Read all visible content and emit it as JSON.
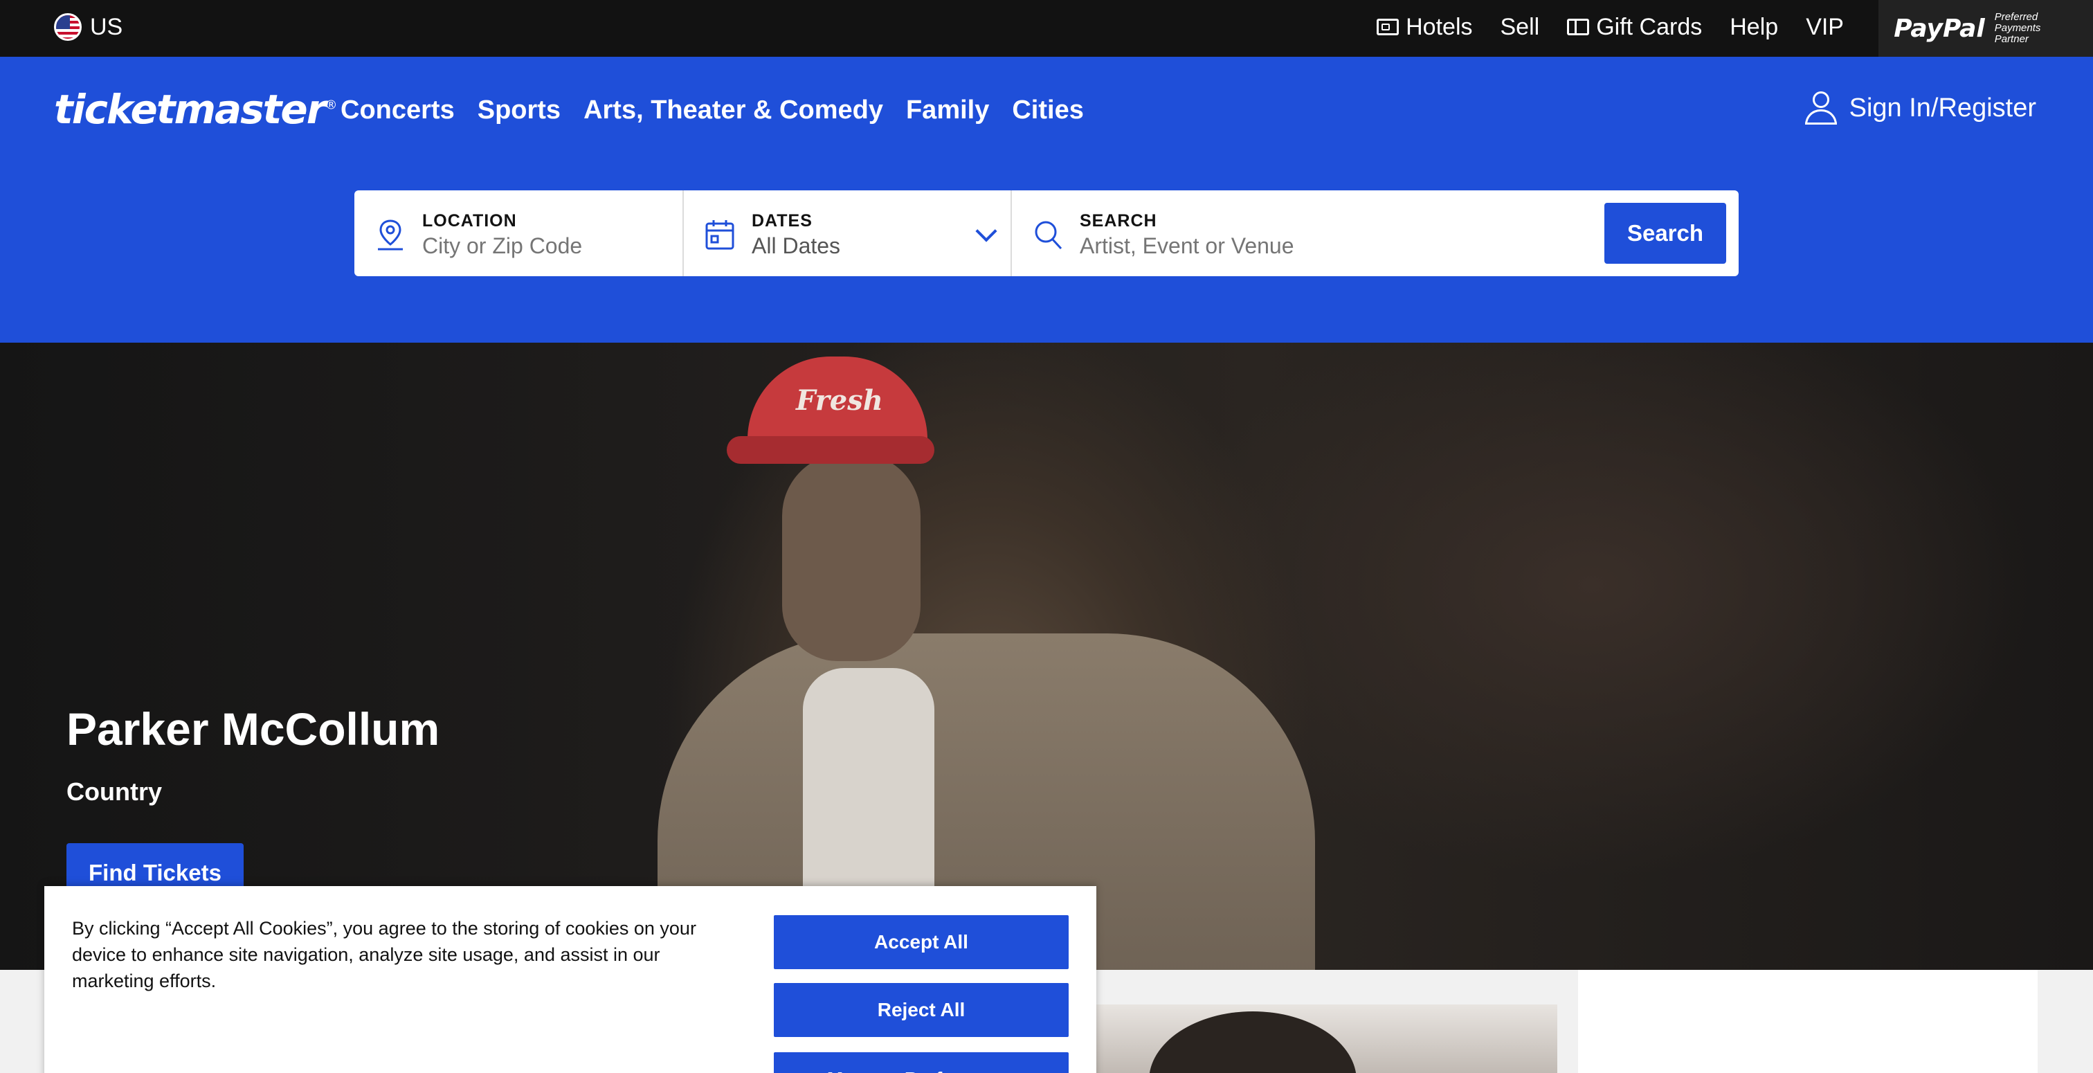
{
  "utility": {
    "region": "US",
    "links": [
      {
        "label": "Hotels",
        "icon": "hotel-icon"
      },
      {
        "label": "Sell"
      },
      {
        "label": "Gift Cards",
        "icon": "gift-card-icon"
      },
      {
        "label": "Help"
      },
      {
        "label": "VIP"
      }
    ],
    "paypal": {
      "logo": "PayPal",
      "tagline": "Preferred Payments Partner"
    }
  },
  "nav": {
    "brand": "ticketmaster",
    "brand_mark": "®",
    "links": [
      "Concerts",
      "Sports",
      "Arts, Theater & Comedy",
      "Family",
      "Cities"
    ],
    "signin": "Sign In/Register"
  },
  "search": {
    "location": {
      "label": "LOCATION",
      "placeholder": "City or Zip Code"
    },
    "dates": {
      "label": "DATES",
      "value": "All Dates"
    },
    "query": {
      "label": "SEARCH",
      "placeholder": "Artist, Event or Venue"
    },
    "button": "Search"
  },
  "hero": {
    "cap_text": "Fresh",
    "title": "Parker McCollum",
    "genre": "Country",
    "cta": "Find Tickets"
  },
  "cookie": {
    "text": "By clicking “Accept All Cookies”, you agree to the storing of cookies on your device to enhance site navigation, analyze site usage, and assist in our marketing efforts.",
    "accept": "Accept All",
    "reject": "Reject All",
    "manage": "Manage Preferences"
  },
  "colors": {
    "brand_blue": "#1f4fd9",
    "utility_bg": "#121212"
  }
}
